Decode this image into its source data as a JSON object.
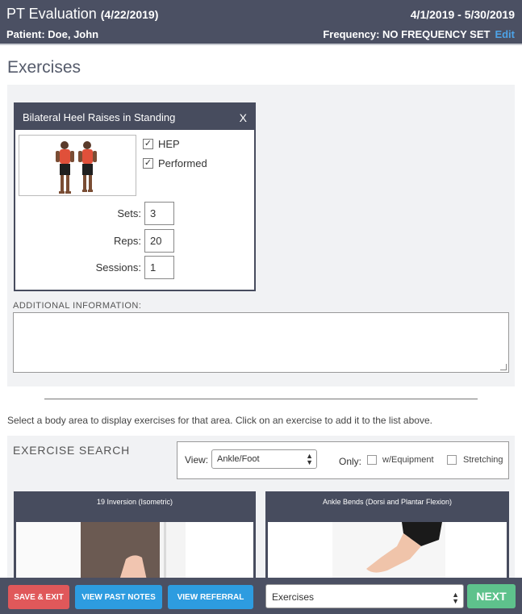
{
  "header": {
    "title": "PT Evaluation",
    "title_date": "(4/22/2019)",
    "date_range": "4/1/2019 - 5/30/2019",
    "patient": "Patient: Doe, John",
    "frequency": "Frequency: NO FREQUENCY SET",
    "edit_label": "Edit"
  },
  "section_title": "Exercises",
  "exercise_card": {
    "name": "Bilateral Heel Raises in Standing",
    "close_label": "X",
    "hep_label": "HEP",
    "hep_checked": true,
    "performed_label": "Performed",
    "performed_checked": true,
    "sets_label": "Sets:",
    "sets_value": "3",
    "reps_label": "Reps:",
    "reps_value": "20",
    "sessions_label": "Sessions:",
    "sessions_value": "1"
  },
  "additional_info": {
    "label": "ADDITIONAL INFORMATION:",
    "value": ""
  },
  "instructions": "Select a body area to display exercises for that area. Click on an exercise to add it to the list above.",
  "exercise_search": {
    "title": "EXERCISE SEARCH",
    "view_label": "View:",
    "view_selected": "Ankle/Foot",
    "only_label": "Only:",
    "equipment_label": "w/Equipment",
    "stretching_label": "Stretching"
  },
  "exercise_tiles": [
    {
      "name": "19 Inversion (Isometric)"
    },
    {
      "name": "Ankle Bends (Dorsi and Plantar Flexion)"
    }
  ],
  "footer": {
    "save_exit": "SAVE & EXIT",
    "view_past_notes": "VIEW PAST NOTES",
    "view_referral": "VIEW REFERRAL",
    "section_select": "Exercises",
    "next": "NEXT"
  },
  "colors": {
    "header_bg": "#4b5063",
    "edit_link": "#4da3e8",
    "save_exit": "#e0585a",
    "blue_button": "#2d9ce0",
    "next_button": "#5ec28c"
  }
}
